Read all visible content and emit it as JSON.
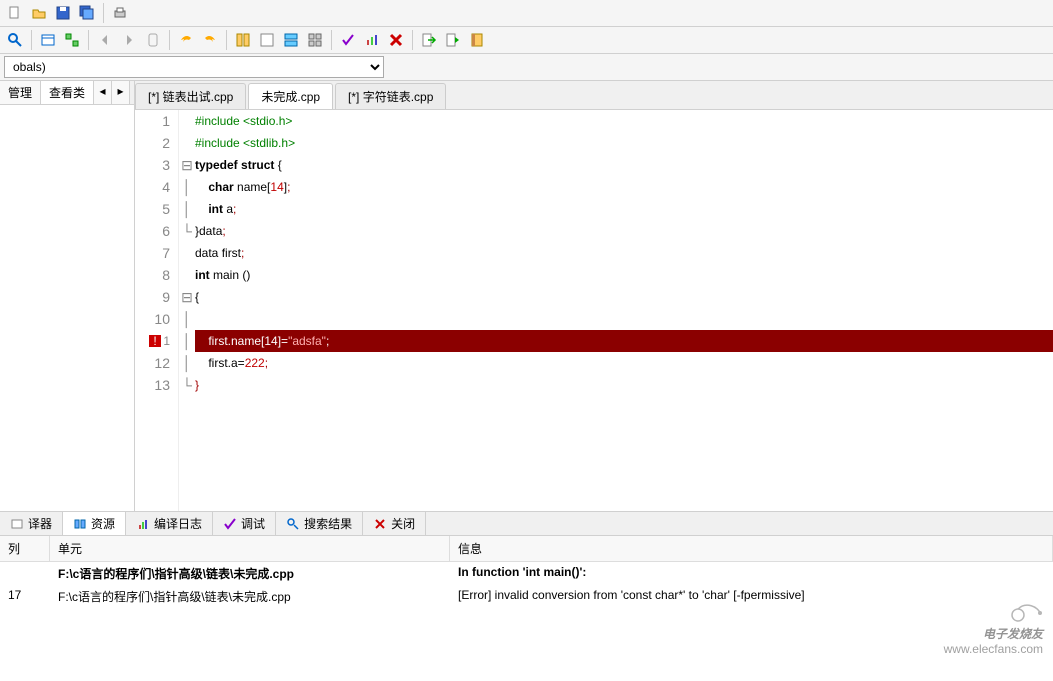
{
  "globals": {
    "label": "obals)"
  },
  "left": {
    "tabs": [
      "管理",
      "查看类"
    ],
    "nav": [
      "◂",
      "▸"
    ]
  },
  "file_tabs": [
    {
      "label": "[*] 链表出试.cpp",
      "active": false
    },
    {
      "label": "未完成.cpp",
      "active": true
    },
    {
      "label": "[*] 字符链表.cpp",
      "active": false
    }
  ],
  "code": {
    "lines": [
      {
        "n": "1",
        "fold": "",
        "html": "<span class='pp'>#include &lt;stdio.h&gt;</span>"
      },
      {
        "n": "2",
        "fold": "",
        "html": "<span class='pp'>#include &lt;stdlib.h&gt;</span>"
      },
      {
        "n": "3",
        "fold": "⊟",
        "html": "<span class='kw'>typedef</span> <span class='kw'>struct</span> {"
      },
      {
        "n": "4",
        "fold": "│",
        "html": "    <span class='kw'>char</span> name[<span class='num'>14</span>]<span class='punc'>;</span>"
      },
      {
        "n": "5",
        "fold": "│",
        "html": "    <span class='kw'>int</span> a<span class='punc'>;</span>"
      },
      {
        "n": "6",
        "fold": "└",
        "html": "}data<span class='punc'>;</span>"
      },
      {
        "n": "7",
        "fold": "",
        "html": "data first<span class='punc'>;</span>"
      },
      {
        "n": "8",
        "fold": "",
        "html": "<span class='kw'>int</span> main ()"
      },
      {
        "n": "9",
        "fold": "⊟",
        "html": "{"
      },
      {
        "n": "10",
        "fold": "│",
        "html": ""
      },
      {
        "n": "11",
        "fold": "│",
        "html": "    first.name[<span class='num'>14</span>]=<span class='str'>\"adsfa\"</span>;",
        "hl": true,
        "err": true
      },
      {
        "n": "12",
        "fold": "│",
        "html": "    first.a=<span class='num'>222</span><span class='punc'>;</span>"
      },
      {
        "n": "13",
        "fold": "└",
        "html": "<span class='punc'>}</span>"
      }
    ]
  },
  "bottom_tabs": [
    {
      "label": "译器",
      "icon": "compiler"
    },
    {
      "label": "资源",
      "icon": "resource",
      "active": true
    },
    {
      "label": "编译日志",
      "icon": "log"
    },
    {
      "label": "调试",
      "icon": "debug"
    },
    {
      "label": "搜索结果",
      "icon": "search"
    },
    {
      "label": "关闭",
      "icon": "close"
    }
  ],
  "msg_headers": {
    "line": "列",
    "unit": "单元",
    "msg": "信息"
  },
  "messages": [
    {
      "line": "",
      "unit": "F:\\c语言的程序们\\指针高级\\链表\\未完成.cpp",
      "msg": "In function 'int main()':",
      "bold": true
    },
    {
      "line": "17",
      "unit": "F:\\c语言的程序们\\指针高级\\链表\\未完成.cpp",
      "msg": "[Error] invalid conversion from 'const char*' to 'char' [-fpermissive]",
      "bold": false
    }
  ],
  "watermark": {
    "brand": "电子发烧友",
    "url": "www.elecfans.com"
  }
}
